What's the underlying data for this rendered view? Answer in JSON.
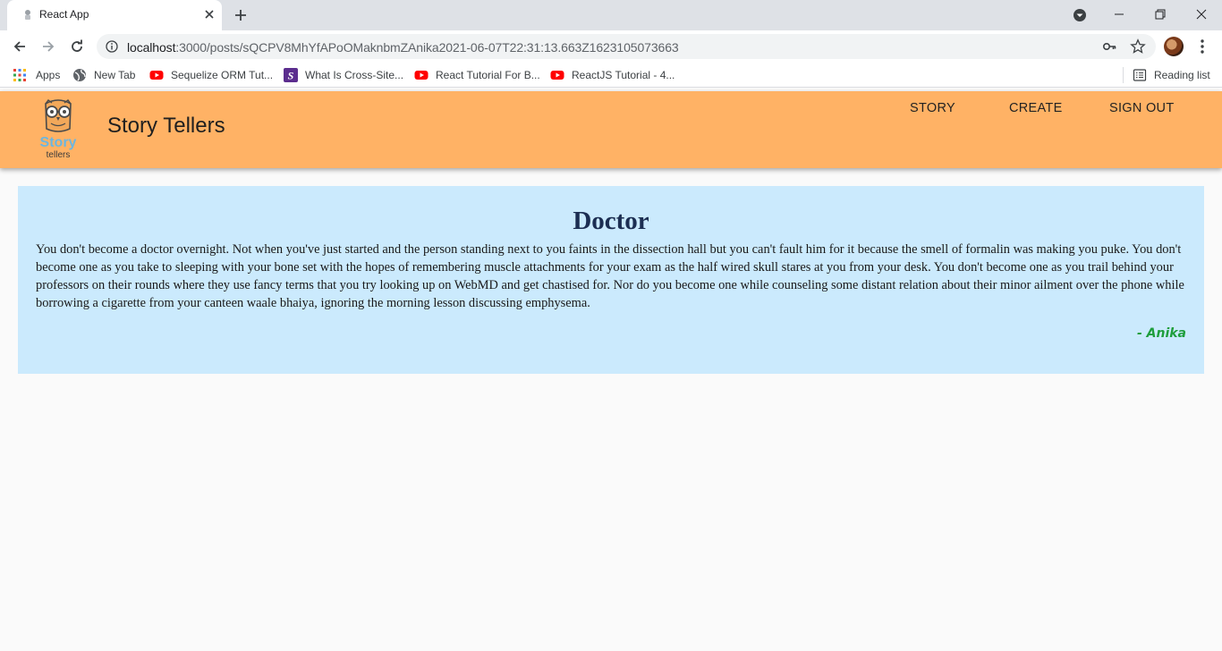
{
  "browser": {
    "tab_title": "React App",
    "url_host": "localhost",
    "url_rest": ":3000/posts/sQCPV8MhYfAPoOMaknbmZAnika2021-06-07T22:31:13.663Z1623105073663",
    "bookmarks": [
      {
        "label": "Apps",
        "icon": "apps-grid-icon"
      },
      {
        "label": "New Tab",
        "icon": "globe-icon"
      },
      {
        "label": "Sequelize ORM Tut...",
        "icon": "youtube-icon"
      },
      {
        "label": "What Is Cross-Site...",
        "icon": "s-logo-icon"
      },
      {
        "label": "React Tutorial For B...",
        "icon": "youtube-icon"
      },
      {
        "label": "ReactJS Tutorial - 4...",
        "icon": "youtube-icon"
      }
    ],
    "reading_list": "Reading list"
  },
  "app": {
    "brand_word1": "Story",
    "brand_word2": "tellers",
    "title": "Story Tellers",
    "nav": {
      "story": "STORY",
      "create": "CREATE",
      "sign_out": "SIGN OUT"
    },
    "header_color": "#ffb265"
  },
  "story": {
    "title": "Doctor",
    "body": "You don't become a doctor overnight. Not when you've just started and the person standing next to you faints in the dissection hall but you can't fault him for it because the smell of formalin was making you puke. You don't become one as you take to sleeping with your bone set with the hopes of remembering muscle attachments for your exam as the half wired skull stares at you from your desk. You don't become one as you trail behind your professors on their rounds where they use fancy terms that you try looking up on WebMD and get chastised for. Nor do you become one while counseling some distant relation about their minor ailment over the phone while borrowing a cigarette from your canteen waale bhaiya, ignoring the morning lesson discussing emphysema.",
    "author": "- Anika",
    "card_color": "#cbeafd"
  }
}
